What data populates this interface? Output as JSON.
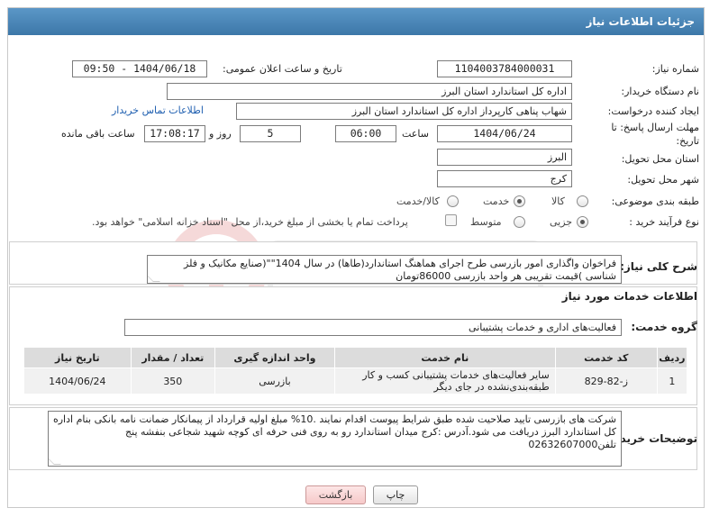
{
  "header": {
    "title": "جزئیات اطلاعات نیاز"
  },
  "fields": {
    "need_number_label": "شماره نیاز:",
    "need_number": "1104003784000031",
    "announce_label": "تاریخ و ساعت اعلان عمومی:",
    "announce_value": "1404/06/18 - 09:50",
    "buyer_org_label": "نام دستگاه خریدار:",
    "buyer_org": "اداره کل استاندارد استان البرز",
    "creator_label": "ایجاد کننده درخواست:",
    "creator": "شهاب پناهی کارپرداز اداره کل استاندارد استان البرز",
    "contact_link": "اطلاعات تماس خریدار",
    "deadline_label_1": "مهلت ارسال پاسخ: تا",
    "deadline_label_2": "تاریخ:",
    "deadline_date": "1404/06/24",
    "time_label": "ساعت",
    "deadline_time": "06:00",
    "days_value": "5",
    "days_label": "روز و",
    "remaining_time": "17:08:17",
    "remaining_label": "ساعت باقی مانده",
    "province_label": "استان محل تحویل:",
    "province": "البرز",
    "city_label": "شهر محل تحویل:",
    "city": "کرج",
    "category_label": "طبقه بندی موضوعی:",
    "category_options": [
      "کالا",
      "خدمت",
      "کالا/خدمت"
    ],
    "category_selected": "خدمت",
    "process_label": "نوع فرآیند خرید :",
    "process_options": [
      "جزیی",
      "متوسط"
    ],
    "process_selected": "جزیی",
    "payment_note": "پرداخت تمام یا بخشی از مبلغ خرید،از محل \"اسناد خزانه اسلامی\" خواهد بود."
  },
  "summary": {
    "label": "شرح کلی نیاز:",
    "text": "فراخوان واگذاری امور بازرسی طرح اجرای هماهنگ استاندارد(طاها) در سال 1404\"\"(صنایع مکانیک و فلز شناسی )قیمت تقریبی هر واحد بازرسی 86000تومان"
  },
  "services": {
    "title": "اطلاعات خدمات مورد نیاز",
    "group_label": "گروه خدمت:",
    "group_value": "فعالیت‌های اداری و خدمات پشتیبانی",
    "columns": [
      "ردیف",
      "کد خدمت",
      "نام خدمت",
      "واحد اندازه گیری",
      "تعداد / مقدار",
      "تاریخ نیاز"
    ],
    "rows": [
      [
        "1",
        "ز-82-829",
        "سایر فعالیت‌های خدمات پشتیبانی کسب و کار طبقه‌بندی‌نشده در جای دیگر",
        "بازرسی",
        "350",
        "1404/06/24"
      ]
    ]
  },
  "buyer_notes": {
    "label": "توضیحات خریدار:",
    "text": "شرکت های بازرسی تایید صلاحیت شده طبق شرایط پیوست اقدام نمایند .10% مبلغ اولیه قرارداد از پیمانکار ضمانت نامه بانکی بنام اداره کل استاندارد البرز دریافت می شود.آدرس :کرج میدان استاندارد رو به روی فنی حرفه ای کوچه شهید شجاعی بنفشه پنج تلفن02632607000"
  },
  "buttons": {
    "print": "چاپ",
    "back": "بازگشت"
  },
  "colors": {
    "header_bg": "#4a86b8",
    "link": "#1f5fb0",
    "back_bg": "#f6c9c9"
  }
}
